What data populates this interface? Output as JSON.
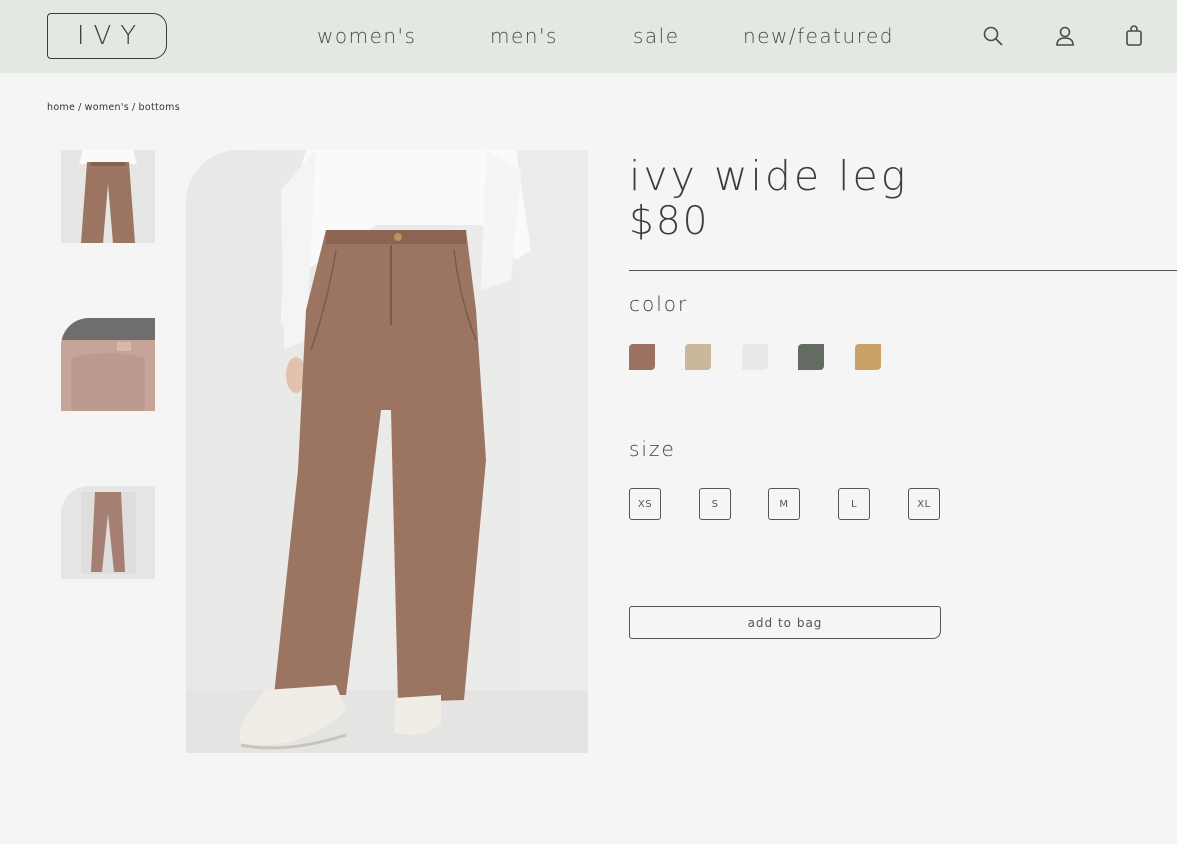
{
  "header": {
    "logo": "IVY",
    "nav": [
      "women's",
      "men's",
      "sale",
      "new/featured"
    ],
    "icons": [
      "search-icon",
      "user-icon",
      "shopping-bag-icon"
    ],
    "background": "#e3e8e2"
  },
  "breadcrumb": [
    "home",
    "women's",
    "bottoms"
  ],
  "breadcrumb_separator": "/",
  "product": {
    "title": "ivy wide leg",
    "price": "$80",
    "color_label": "color",
    "colors": [
      "#9b7262",
      "#cbb89a",
      "#e9e9e9",
      "#636b62",
      "#c9a265"
    ],
    "size_label": "size",
    "sizes": [
      "XS",
      "S",
      "M",
      "L",
      "XL"
    ],
    "add_to_bag": "add to bag"
  },
  "gallery": {
    "thumbnails": [
      "front view",
      "back view",
      "flat view"
    ]
  }
}
